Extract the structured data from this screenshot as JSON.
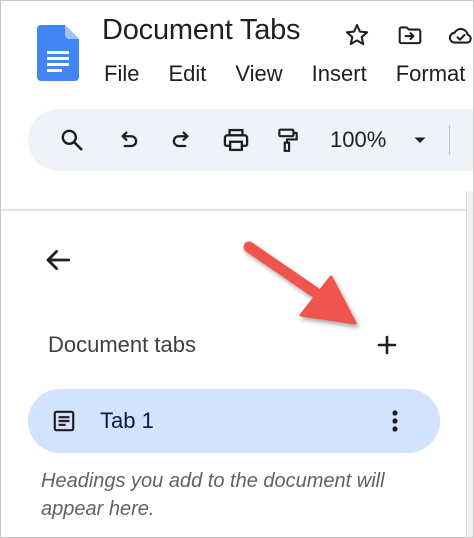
{
  "app": {
    "title": "Document Tabs",
    "logo": "google-docs-icon"
  },
  "header": {
    "icons": [
      "star-icon",
      "move-to-folder-icon",
      "cloud-status-icon"
    ],
    "menu": [
      "File",
      "Edit",
      "View",
      "Insert",
      "Format"
    ]
  },
  "toolbar": {
    "icons": [
      "search-icon",
      "undo-icon",
      "redo-icon",
      "print-icon",
      "paint-format-icon",
      "chevron-down-icon"
    ],
    "zoom": "100%"
  },
  "sidebar": {
    "back_icon": "arrow-back-icon",
    "heading": "Document tabs",
    "add_icon": "plus-icon",
    "tabs": [
      {
        "label": "Tab 1",
        "icon": "document-outline-icon",
        "menu_icon": "more-vertical-icon",
        "selected": true
      }
    ],
    "hint": "Headings you add to the document will appear here."
  },
  "annotation": {
    "arrow_color": "#f0554d"
  },
  "colors": {
    "docs_blue": "#4285f4",
    "toolbar_bg": "#eef2f9",
    "selected_tab_bg": "#d3e3fd",
    "selected_tab_text": "#041e49"
  }
}
